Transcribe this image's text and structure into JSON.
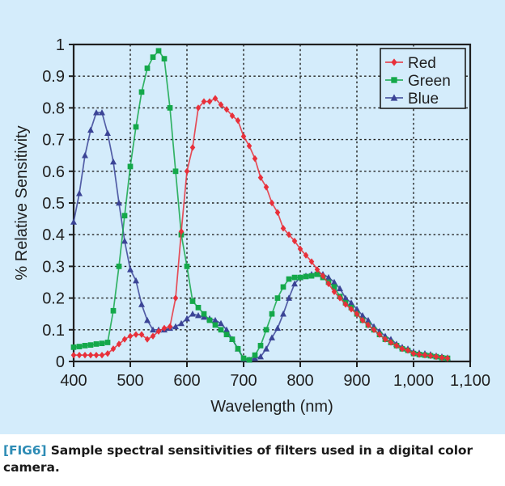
{
  "figure": {
    "caption_tag": "[FIG6]",
    "caption_text": "Sample spectral sensitivities of filters used in a digital color camera.",
    "background_color": "#d4ecfb",
    "caption_background": "#ffffff",
    "tag_color": "#2e8cb5"
  },
  "chart_data": {
    "type": "line",
    "title": "",
    "xlabel": "Wavelength (nm)",
    "ylabel": "% Relative Sensitivity",
    "xlim": [
      400,
      1100
    ],
    "ylim": [
      0,
      1
    ],
    "xticks": [
      400,
      500,
      600,
      700,
      800,
      900,
      1000,
      1100
    ],
    "xticklabels": [
      "400",
      "500",
      "600",
      "700",
      "800",
      "900",
      "1,000",
      "1,100"
    ],
    "yticks": [
      0,
      0.1,
      0.2,
      0.3,
      0.4,
      0.5,
      0.6,
      0.7,
      0.8,
      0.9,
      1
    ],
    "yticklabels": [
      "0",
      "0.1",
      "0.2",
      "0.3",
      "0.4",
      "0.5",
      "0.6",
      "0.7",
      "0.8",
      "0.9",
      "1"
    ],
    "grid": true,
    "grid_style": "dotted",
    "legend_position": "top-right",
    "x": [
      400,
      410,
      420,
      430,
      440,
      450,
      460,
      470,
      480,
      490,
      500,
      510,
      520,
      530,
      540,
      550,
      560,
      570,
      580,
      590,
      600,
      610,
      620,
      630,
      640,
      650,
      660,
      670,
      680,
      690,
      700,
      710,
      720,
      730,
      740,
      750,
      760,
      770,
      780,
      790,
      800,
      810,
      820,
      830,
      840,
      850,
      860,
      870,
      880,
      890,
      900,
      910,
      920,
      930,
      940,
      950,
      960,
      970,
      980,
      990,
      1000,
      1010,
      1020,
      1030,
      1040,
      1050,
      1060
    ],
    "series": [
      {
        "name": "Red",
        "color": "#e8303a",
        "marker": "diamond",
        "values": [
          0.02,
          0.02,
          0.02,
          0.02,
          0.02,
          0.02,
          0.025,
          0.04,
          0.055,
          0.07,
          0.08,
          0.085,
          0.085,
          0.07,
          0.08,
          0.095,
          0.105,
          0.11,
          0.2,
          0.41,
          0.6,
          0.675,
          0.8,
          0.82,
          0.82,
          0.83,
          0.81,
          0.795,
          0.775,
          0.76,
          0.71,
          0.68,
          0.64,
          0.58,
          0.55,
          0.5,
          0.47,
          0.42,
          0.4,
          0.38,
          0.355,
          0.335,
          0.315,
          0.29,
          0.27,
          0.245,
          0.22,
          0.2,
          0.18,
          0.165,
          0.15,
          0.13,
          0.115,
          0.1,
          0.085,
          0.07,
          0.06,
          0.05,
          0.04,
          0.035,
          0.025,
          0.022,
          0.02,
          0.018,
          0.015,
          0.012,
          0.01
        ],
        "peak_x": 650,
        "peak_y": 0.83
      },
      {
        "name": "Green",
        "color": "#14a84a",
        "marker": "square",
        "values": [
          0.045,
          0.047,
          0.05,
          0.052,
          0.055,
          0.057,
          0.06,
          0.16,
          0.3,
          0.46,
          0.615,
          0.74,
          0.85,
          0.925,
          0.96,
          0.98,
          0.955,
          0.8,
          0.6,
          0.4,
          0.3,
          0.19,
          0.17,
          0.15,
          0.13,
          0.115,
          0.1,
          0.085,
          0.07,
          0.04,
          0.01,
          0.005,
          0.02,
          0.05,
          0.1,
          0.15,
          0.2,
          0.235,
          0.26,
          0.265,
          0.265,
          0.268,
          0.27,
          0.275,
          0.265,
          0.25,
          0.235,
          0.205,
          0.185,
          0.17,
          0.15,
          0.13,
          0.115,
          0.1,
          0.085,
          0.07,
          0.06,
          0.05,
          0.04,
          0.035,
          0.025,
          0.022,
          0.02,
          0.018,
          0.015,
          0.012,
          0.01
        ],
        "peak_x": 550,
        "peak_y": 0.98
      },
      {
        "name": "Blue",
        "color": "#3b4496",
        "marker": "triangle",
        "values": [
          0.44,
          0.53,
          0.65,
          0.73,
          0.785,
          0.785,
          0.72,
          0.63,
          0.5,
          0.38,
          0.29,
          0.255,
          0.18,
          0.13,
          0.1,
          0.1,
          0.1,
          0.105,
          0.11,
          0.12,
          0.135,
          0.15,
          0.145,
          0.14,
          0.135,
          0.13,
          0.12,
          0.1,
          0.07,
          0.04,
          0.008,
          0.005,
          0.01,
          0.015,
          0.04,
          0.075,
          0.105,
          0.15,
          0.2,
          0.245,
          0.265,
          0.27,
          0.275,
          0.28,
          0.275,
          0.265,
          0.25,
          0.23,
          0.2,
          0.185,
          0.165,
          0.145,
          0.13,
          0.11,
          0.095,
          0.08,
          0.07,
          0.055,
          0.045,
          0.04,
          0.03,
          0.027,
          0.025,
          0.022,
          0.018,
          0.015,
          0.012
        ],
        "peak_x": 445,
        "peak_y": 0.785
      }
    ],
    "legend": [
      {
        "label": "Red",
        "color": "#e8303a",
        "marker": "diamond"
      },
      {
        "label": "Green",
        "color": "#14a84a",
        "marker": "square"
      },
      {
        "label": "Blue",
        "color": "#3b4496",
        "marker": "triangle"
      }
    ]
  }
}
